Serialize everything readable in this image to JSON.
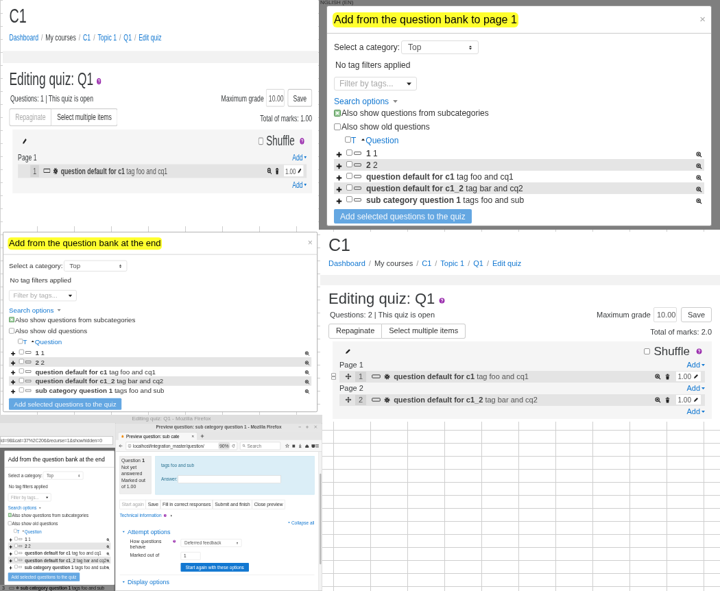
{
  "panels": [
    {
      "kind": "quiz_editor",
      "course_title": "C1",
      "breadcrumb": {
        "separator": "/",
        "items": [
          {
            "label": "Dashboard",
            "link": true
          },
          {
            "label": "My courses",
            "link": false
          },
          {
            "label": "C1",
            "link": true
          },
          {
            "label": "Topic 1",
            "link": true
          },
          {
            "label": "Q1",
            "link": true
          },
          {
            "label": "Edit quiz",
            "link": true
          }
        ]
      },
      "heading": "Editing quiz: Q1",
      "summary": "Questions: 1 | This quiz is open",
      "max_grade": {
        "label": "Maximum grade",
        "value": "10.00"
      },
      "save": "Save",
      "tools": [
        {
          "label": "Repaginate",
          "disabled": true
        },
        {
          "label": "Select multiple items",
          "disabled": false
        }
      ],
      "total_marks": "Total of marks: 1.00",
      "shuffle": {
        "label": "Shuffle",
        "checked": false
      },
      "pages": [
        {
          "label": "Page 1",
          "add": "Add",
          "slots": [
            {
              "number": "1",
              "movable": false,
              "name": "question default for c1",
              "text": "tag foo and cq1",
              "mark": "1.00"
            }
          ]
        }
      ],
      "final_add": "Add"
    },
    {
      "kind": "bank_modal",
      "backdrop_text": "NGLISH (EN)",
      "title": "Add from the question bank to page 1",
      "highlighted": true,
      "close": "×",
      "category_label": "Select a category:",
      "category": "Top",
      "tag_status": "No tag filters applied",
      "tag_placeholder": "Filter by tags...",
      "search_options": "Search options",
      "options": [
        {
          "label": "Also show questions from subcategories",
          "checked": true
        },
        {
          "label": "Also show old questions",
          "checked": false
        }
      ],
      "columns": [
        "T",
        "Question"
      ],
      "all_checked": false,
      "questions": [
        {
          "name": "1",
          "text": "1",
          "checked": false
        },
        {
          "name": "2",
          "text": "2",
          "checked": false
        },
        {
          "name": "question default for c1",
          "text": "tag foo and cq1",
          "checked": false
        },
        {
          "name": "question default for c1_2",
          "text": "tag bar and cq2",
          "checked": false
        },
        {
          "name": "sub category question 1",
          "text": "tags foo and sub",
          "checked": false
        }
      ],
      "submit": "Add selected questions to the quiz"
    },
    {
      "kind": "bank_modal",
      "title": "Add from the question bank at the end",
      "highlighted": true,
      "close": "×",
      "category_label": "Select a category:",
      "category": "Top",
      "tag_status": "No tag filters applied",
      "tag_placeholder": "Filter by tags...",
      "search_options": "Search options",
      "options": [
        {
          "label": "Also show questions from subcategories",
          "checked": true
        },
        {
          "label": "Also show old questions",
          "checked": false
        }
      ],
      "columns": [
        "T",
        "Question"
      ],
      "all_checked": false,
      "questions": [
        {
          "name": "1",
          "text": "1",
          "checked": false
        },
        {
          "name": "2",
          "text": "2",
          "checked": false
        },
        {
          "name": "question default for c1",
          "text": "tag foo and cq1",
          "checked": false
        },
        {
          "name": "question default for c1_2",
          "text": "tag bar and cq2",
          "checked": false
        },
        {
          "name": "sub category question 1",
          "text": "tags foo and sub",
          "checked": false
        }
      ],
      "submit": "Add selected questions to the quiz"
    },
    {
      "kind": "quiz_editor",
      "course_title": "C1",
      "breadcrumb": {
        "separator": "/",
        "items": [
          {
            "label": "Dashboard",
            "link": true
          },
          {
            "label": "My courses",
            "link": false
          },
          {
            "label": "C1",
            "link": true
          },
          {
            "label": "Topic 1",
            "link": true
          },
          {
            "label": "Q1",
            "link": true
          },
          {
            "label": "Edit quiz",
            "link": true
          }
        ]
      },
      "heading": "Editing quiz: Q1",
      "summary": "Questions: 2 | This quiz is open",
      "max_grade": {
        "label": "Maximum grade",
        "value": "10.00"
      },
      "save": "Save",
      "tools": [
        {
          "label": "Repaginate",
          "disabled": false
        },
        {
          "label": "Select multiple items",
          "disabled": false
        }
      ],
      "total_marks": "Total of marks: 2.0",
      "shuffle": {
        "label": "Shuffle",
        "checked": false
      },
      "pages": [
        {
          "label": "Page 1",
          "add": "Add",
          "slots": [
            {
              "number": "1",
              "movable": true,
              "name": "question default for c1",
              "text": "tag foo and cq1",
              "mark": "1.00"
            }
          ]
        },
        {
          "label": "Page 2",
          "add": "Add",
          "slots": [
            {
              "number": "2",
              "movable": true,
              "name": "question default for c1_2",
              "text": "tag bar and cq2",
              "mark": "1.00"
            }
          ]
        }
      ],
      "final_add": "Add"
    },
    {
      "kind": "background_window",
      "title": "Editing quiz: Q1 - Mozilla Firefox",
      "url": "id=98&cat=37%2C206&recurse=1&showhidden=0",
      "modal": {
        "title": "Add from the question bank at the end",
        "highlighted": false,
        "category_label": "Select a category:",
        "category": "Top",
        "tag_status": "No tag filters applied",
        "tag_placeholder": "Filter by tags...",
        "search_options": "Search options",
        "options": [
          {
            "label": "Also show questions from subcategories",
            "checked": true
          },
          {
            "label": "Also show old questions",
            "checked": false
          }
        ],
        "columns": [
          "T",
          "Question"
        ],
        "all_checked": false,
        "questions": [
          {
            "name": "1",
            "text": "1",
            "checked": false
          },
          {
            "name": "2",
            "text": "2",
            "checked": false
          },
          {
            "name": "question default for c1",
            "text": "tag foo and cq1",
            "checked": false
          },
          {
            "name": "question default for c1_2",
            "text": "tag bar and cq2",
            "checked": false
          },
          {
            "name": "sub category question 1",
            "text": "tags foo and sub",
            "checked": false
          }
        ],
        "submit": "Add selected questions to the quiz"
      },
      "behind_row": {
        "number": "3",
        "name": "sub category question 1",
        "text": "tags foo and sub"
      }
    },
    {
      "kind": "preview_window",
      "title": "Preview question: sub category question 1 - Mozilla Firefox",
      "tab": "Preview question: sub cate",
      "url": "localhost/integration_master/question/",
      "zoom": "90%",
      "search": "Search",
      "info": {
        "label": "Question",
        "number": "1",
        "state": "Not yet answered",
        "marked": "Marked out of 1.00"
      },
      "question_text": "tags foo and sub",
      "answer_label": "Answer:",
      "actions": [
        {
          "label": "Start again",
          "disabled": true
        },
        {
          "label": "Save",
          "disabled": false
        },
        {
          "label": "Fill in correct responses",
          "disabled": false
        },
        {
          "label": "Submit and finish",
          "disabled": false
        },
        {
          "label": "Close preview",
          "disabled": false
        }
      ],
      "tech_info": "Technical information",
      "collapse_all": "Collapse all",
      "sections": [
        {
          "title": "Attempt options",
          "expanded": true,
          "fields": [
            {
              "kind": "select",
              "label": "How questions behave",
              "help": true,
              "value": "Deferred feedback"
            },
            {
              "kind": "input",
              "label": "Marked out of",
              "help": false,
              "value": "1"
            }
          ],
          "button": "Start again with these options"
        },
        {
          "title": "Display options",
          "expanded": true
        }
      ]
    }
  ]
}
